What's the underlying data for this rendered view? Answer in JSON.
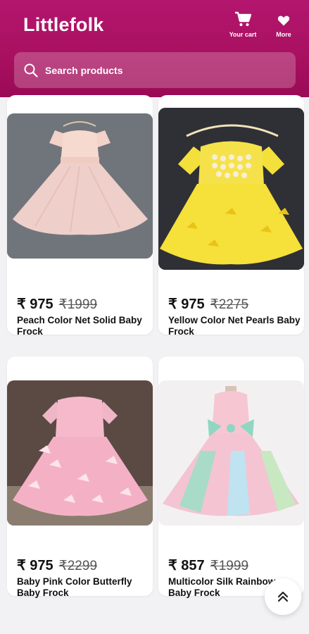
{
  "header": {
    "brand": "Littlefolk",
    "cart_label": "Your cart",
    "more_label": "More"
  },
  "search": {
    "placeholder": "Search products"
  },
  "products": [
    {
      "price": "₹ 975",
      "mrp": "₹1999",
      "title": "Peach Color Net Solid Baby Frock"
    },
    {
      "price": "₹ 975",
      "mrp": "₹2275",
      "title": "Yellow Color Net Pearls Baby Frock"
    },
    {
      "price": "₹ 975",
      "mrp": "₹2299",
      "title": "Baby Pink Color Butterfly Baby Frock"
    },
    {
      "price": "₹ 857",
      "mrp": "₹1999",
      "title": "Multicolor Silk Rainbow Baby Frock"
    }
  ],
  "icons": {
    "search": "search-icon",
    "cart": "cart-icon",
    "more": "heart-icon",
    "scroll_top": "double-chevron-up-icon"
  },
  "colors": {
    "brand": "#a8105f"
  }
}
